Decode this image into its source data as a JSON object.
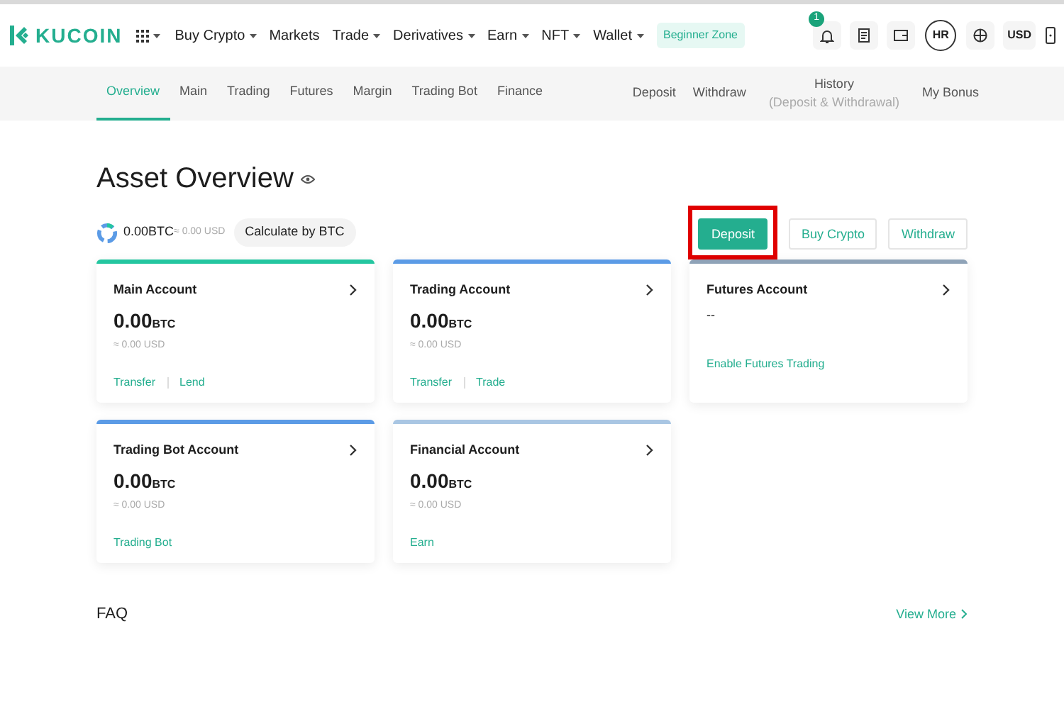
{
  "logo": {
    "text": "KUCOIN"
  },
  "nav": [
    {
      "label": "Buy Crypto",
      "dropdown": true
    },
    {
      "label": "Markets",
      "dropdown": false
    },
    {
      "label": "Trade",
      "dropdown": true
    },
    {
      "label": "Derivatives",
      "dropdown": true
    },
    {
      "label": "Earn",
      "dropdown": true
    },
    {
      "label": "NFT",
      "dropdown": true
    },
    {
      "label": "Wallet",
      "dropdown": true
    }
  ],
  "beginner_zone": "Beginner Zone",
  "notification_count": "1",
  "avatar": "HR",
  "currency": "USD",
  "subnav_left": [
    {
      "label": "Overview",
      "selected": true
    },
    {
      "label": "Main",
      "selected": false
    },
    {
      "label": "Trading",
      "selected": false
    },
    {
      "label": "Futures",
      "selected": false
    },
    {
      "label": "Margin",
      "selected": false
    },
    {
      "label": "Trading Bot",
      "selected": false
    },
    {
      "label": "Finance",
      "selected": false
    }
  ],
  "subnav_right": [
    {
      "label": "Deposit"
    },
    {
      "label": "Withdraw"
    },
    {
      "label": "History",
      "sublabel": "(Deposit & Withdrawal)"
    },
    {
      "label": "My Bonus"
    }
  ],
  "title": "Asset Overview",
  "total": {
    "btc": "0.00BTC",
    "usd": "≈ 0.00 USD",
    "calc_button": "Calculate by BTC"
  },
  "actions": [
    {
      "label": "Deposit",
      "kind": "primary",
      "highlighted": true
    },
    {
      "label": "Buy Crypto",
      "kind": "outline",
      "highlighted": false
    },
    {
      "label": "Withdraw",
      "kind": "outline",
      "highlighted": false
    }
  ],
  "accounts": [
    {
      "name": "Main Account",
      "color": "#24c6a0",
      "amount": "0.00",
      "unit": "BTC",
      "usd": "≈ 0.00 USD",
      "links": [
        "Transfer",
        "Lend"
      ]
    },
    {
      "name": "Trading Account",
      "color": "#5b9be6",
      "amount": "0.00",
      "unit": "BTC",
      "usd": "≈ 0.00 USD",
      "links": [
        "Transfer",
        "Trade"
      ]
    },
    {
      "name": "Futures Account",
      "color": "#8fa3b8",
      "amount": "--",
      "links": [
        "Enable Futures Trading"
      ]
    },
    {
      "name": "Trading Bot Account",
      "color": "#5b9be6",
      "amount": "0.00",
      "unit": "BTC",
      "usd": "≈ 0.00 USD",
      "links": [
        "Trading Bot"
      ]
    },
    {
      "name": "Financial Account",
      "color": "#a9c6e3",
      "amount": "0.00",
      "unit": "BTC",
      "usd": "≈ 0.00 USD",
      "links": [
        "Earn"
      ]
    }
  ],
  "faq": {
    "title": "FAQ",
    "link": "View More"
  }
}
